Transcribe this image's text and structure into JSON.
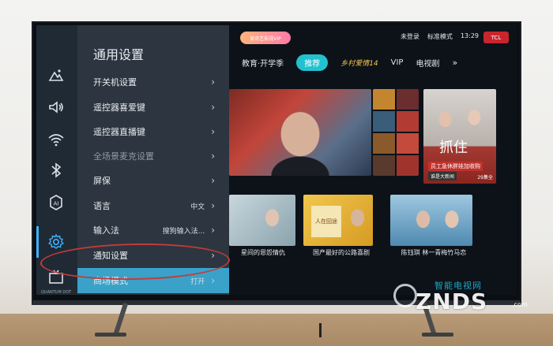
{
  "settings_menu": {
    "title": "通用设置",
    "items": [
      {
        "label": "开关机设置",
        "value": "",
        "state": "normal"
      },
      {
        "label": "遥控器喜爱键",
        "value": "",
        "state": "normal"
      },
      {
        "label": "遥控器直播键",
        "value": "",
        "state": "normal"
      },
      {
        "label": "全场景麦克设置",
        "value": "",
        "state": "disabled"
      },
      {
        "label": "屏保",
        "value": "",
        "state": "normal"
      },
      {
        "label": "语言",
        "value": "中文",
        "state": "normal"
      },
      {
        "label": "输入法",
        "value": "搜狗输入法...",
        "state": "normal"
      },
      {
        "label": "通知设置",
        "value": "",
        "state": "normal"
      },
      {
        "label": "商场模式",
        "value": "打开",
        "state": "selected"
      }
    ],
    "chevron": "›"
  },
  "rail_icons": [
    "picture-icon",
    "sound-icon",
    "wifi-icon",
    "bluetooth-icon",
    "ai-icon",
    "gear-icon",
    "input-source-icon"
  ],
  "topbar": {
    "vip_pill": "爱奇艺影视VIP",
    "login": "未登录",
    "mode": "标准模式",
    "time": "13:29",
    "brand": "TCL"
  },
  "tabs": [
    "教育·开学季",
    "推荐",
    "乡村爱情14",
    "VIP",
    "电视剧"
  ],
  "active_tab": "推荐",
  "tab_more": "»",
  "tiles": {
    "poster_cap": "员工急休胖娃加收购",
    "poster_sub": "谁是大新闻",
    "poster_date": "29集全",
    "poster_title": "抓住",
    "row2": [
      {
        "title": "星间的恩怨情仇"
      },
      {
        "title": "国产最好的公路喜剧",
        "overlay": "人在囧途"
      },
      {
        "title": "陈钰琪 林一青梅竹马恋"
      }
    ]
  },
  "watermark": {
    "cn": "智能电视网",
    "en": "ZNDS",
    "dotcom": ".com"
  },
  "brand_strip": "QUANTUM DOT",
  "colors": {
    "selected_menu": "#3aa2c9",
    "active_tab": "#22c1d0",
    "annotation_ring": "#c23b3b"
  }
}
